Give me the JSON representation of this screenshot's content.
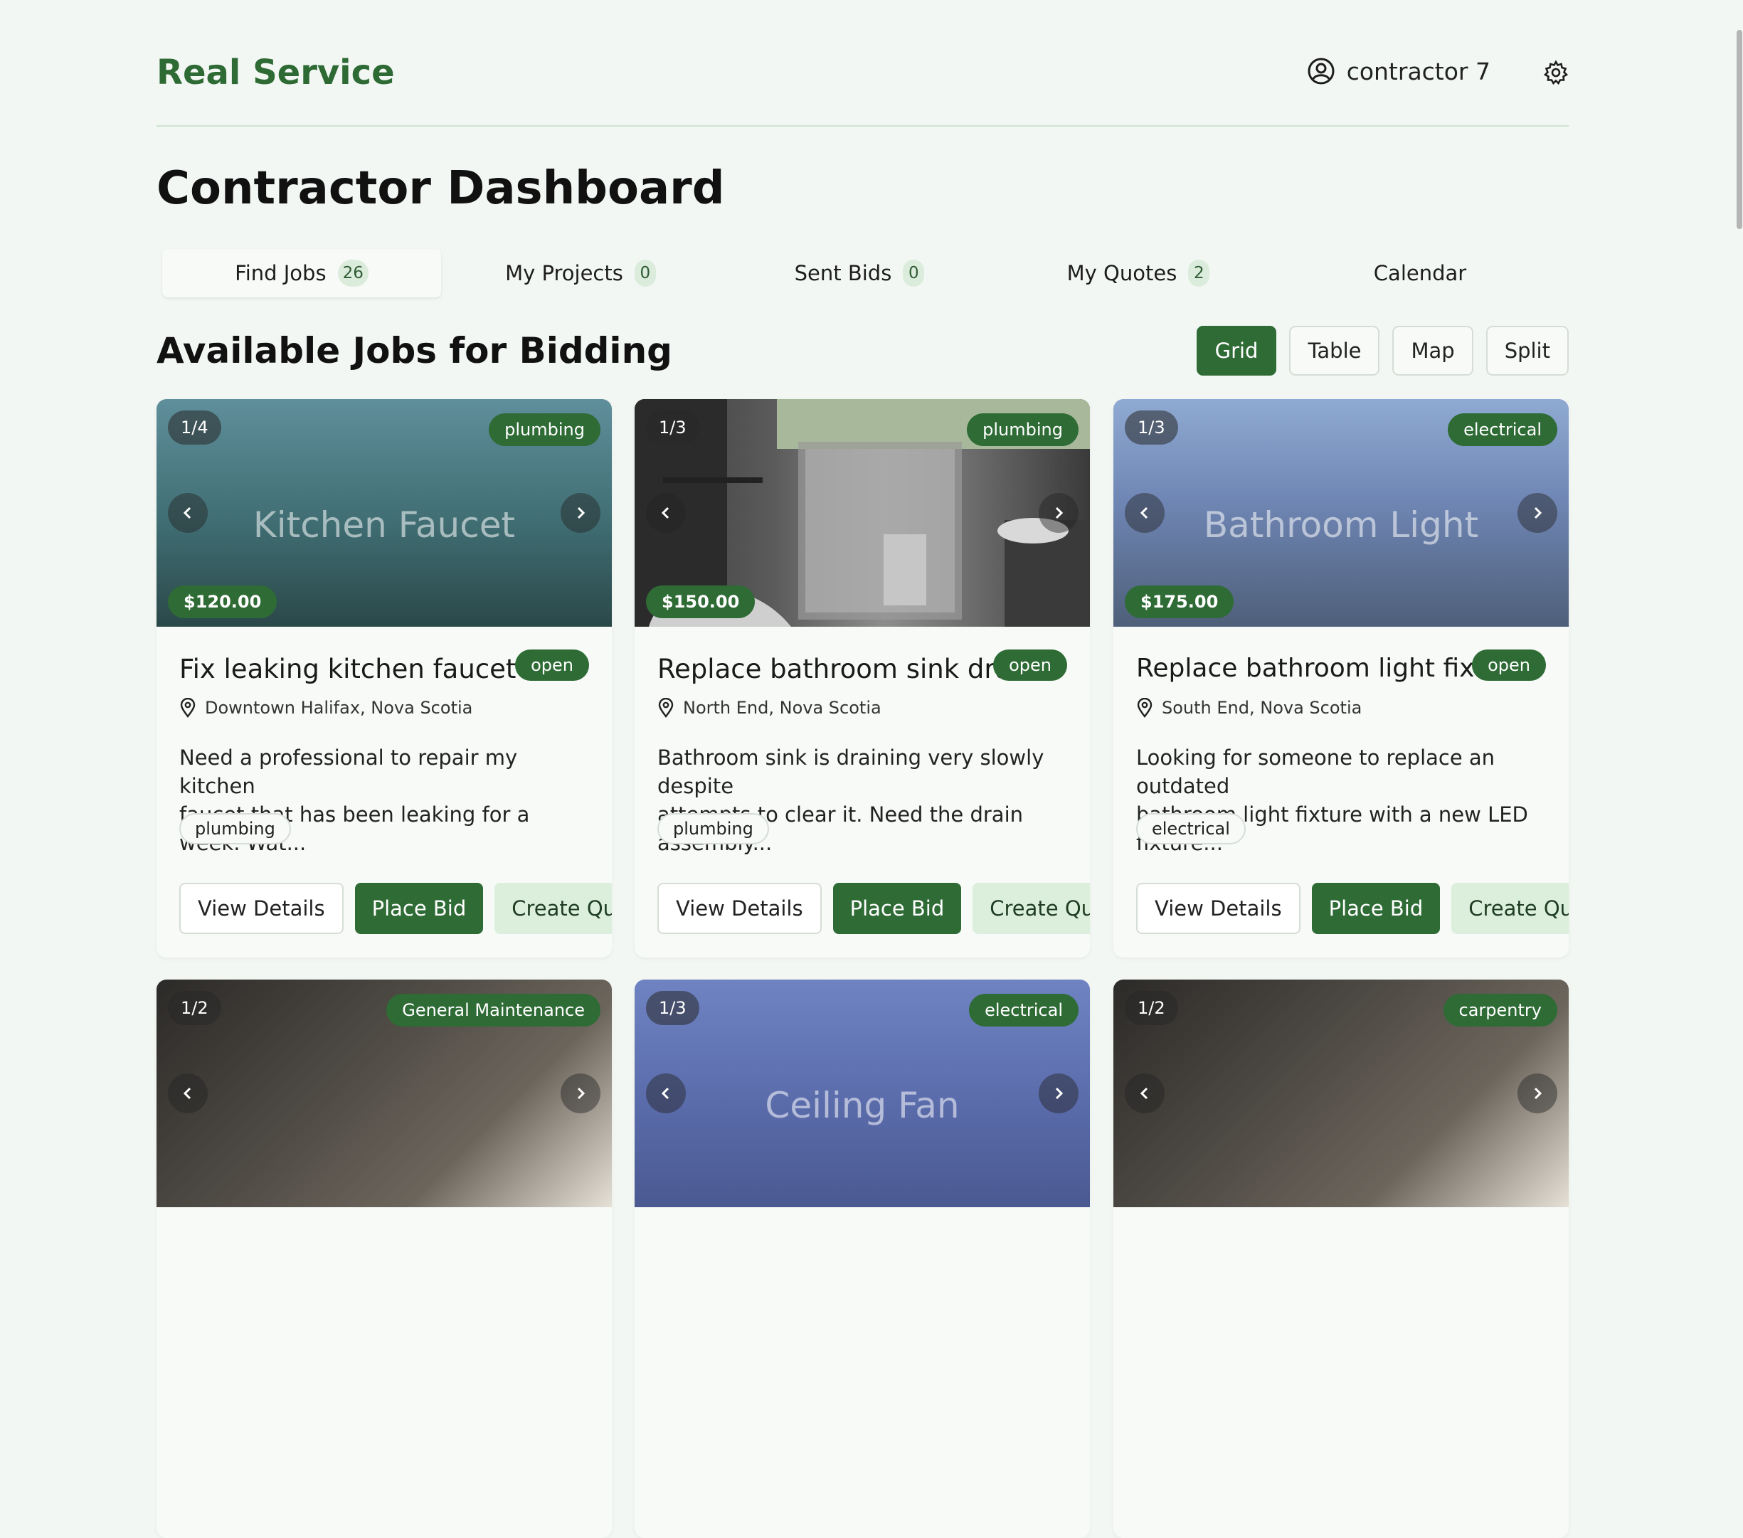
{
  "app": {
    "brand": "Real Service",
    "user_name": "contractor 7"
  },
  "page_title": "Contractor Dashboard",
  "tabs": [
    {
      "label": "Find Jobs",
      "count": "26"
    },
    {
      "label": "My Projects",
      "count": "0"
    },
    {
      "label": "Sent Bids",
      "count": "0"
    },
    {
      "label": "My Quotes",
      "count": "2"
    },
    {
      "label": "Calendar"
    }
  ],
  "section_title": "Available Jobs for Bidding",
  "view_modes": [
    "Grid",
    "Table",
    "Map",
    "Split"
  ],
  "active_view": "Grid",
  "colors": {
    "brand": "#2d6a34",
    "accent": "#2e6b35",
    "soft": "#dcefdc"
  },
  "jobs": [
    {
      "counter": "1/4",
      "category": "plumbing",
      "media_label": "Kitchen Faucet",
      "price": "$120.00",
      "title": "Fix leaking kitchen faucet",
      "status": "open",
      "location": "Downtown Halifax, Nova Scotia",
      "description_line1": "Need a professional to repair my kitchen",
      "description_line2": "faucet that has been leaking for a week. Wat...",
      "tag": "plumbing"
    },
    {
      "counter": "1/3",
      "category": "plumbing",
      "price": "$150.00",
      "title": "Replace bathroom sink drain",
      "status": "open",
      "location": "North End, Nova Scotia",
      "description_line1": "Bathroom sink is draining very slowly despite",
      "description_line2": "attempts to clear it. Need the drain assembly...",
      "tag": "plumbing"
    },
    {
      "counter": "1/3",
      "category": "electrical",
      "media_label": "Bathroom Light",
      "price": "$175.00",
      "title": "Replace bathroom light fixture",
      "status": "open",
      "location": "South End, Nova Scotia",
      "description_line1": "Looking for someone to replace an outdated",
      "description_line2": "bathroom light fixture with a new LED fixture...",
      "tag": "electrical"
    },
    {
      "counter": "1/2",
      "category": "General Maintenance"
    },
    {
      "counter": "1/3",
      "category": "electrical",
      "media_label": "Ceiling Fan"
    },
    {
      "counter": "1/2",
      "category": "carpentry"
    }
  ],
  "card_actions": {
    "view": "View Details",
    "bid": "Place Bid",
    "quote": "Create Quote"
  },
  "icons": {
    "user": "user-circle-icon",
    "settings": "gear-icon",
    "location": "map-pin-icon",
    "prev": "chevron-left-icon",
    "next": "chevron-right-icon"
  }
}
